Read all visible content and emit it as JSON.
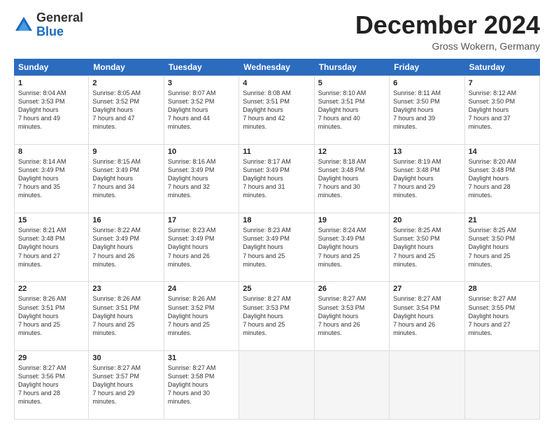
{
  "logo": {
    "general": "General",
    "blue": "Blue"
  },
  "header": {
    "month": "December 2024",
    "location": "Gross Wokern, Germany"
  },
  "days": [
    "Sunday",
    "Monday",
    "Tuesday",
    "Wednesday",
    "Thursday",
    "Friday",
    "Saturday"
  ],
  "weeks": [
    [
      {
        "day": "1",
        "sunrise": "8:04 AM",
        "sunset": "3:53 PM",
        "daylight": "7 hours and 49 minutes."
      },
      {
        "day": "2",
        "sunrise": "8:05 AM",
        "sunset": "3:52 PM",
        "daylight": "7 hours and 47 minutes."
      },
      {
        "day": "3",
        "sunrise": "8:07 AM",
        "sunset": "3:52 PM",
        "daylight": "7 hours and 44 minutes."
      },
      {
        "day": "4",
        "sunrise": "8:08 AM",
        "sunset": "3:51 PM",
        "daylight": "7 hours and 42 minutes."
      },
      {
        "day": "5",
        "sunrise": "8:10 AM",
        "sunset": "3:51 PM",
        "daylight": "7 hours and 40 minutes."
      },
      {
        "day": "6",
        "sunrise": "8:11 AM",
        "sunset": "3:50 PM",
        "daylight": "7 hours and 39 minutes."
      },
      {
        "day": "7",
        "sunrise": "8:12 AM",
        "sunset": "3:50 PM",
        "daylight": "7 hours and 37 minutes."
      }
    ],
    [
      {
        "day": "8",
        "sunrise": "8:14 AM",
        "sunset": "3:49 PM",
        "daylight": "7 hours and 35 minutes."
      },
      {
        "day": "9",
        "sunrise": "8:15 AM",
        "sunset": "3:49 PM",
        "daylight": "7 hours and 34 minutes."
      },
      {
        "day": "10",
        "sunrise": "8:16 AM",
        "sunset": "3:49 PM",
        "daylight": "7 hours and 32 minutes."
      },
      {
        "day": "11",
        "sunrise": "8:17 AM",
        "sunset": "3:49 PM",
        "daylight": "7 hours and 31 minutes."
      },
      {
        "day": "12",
        "sunrise": "8:18 AM",
        "sunset": "3:48 PM",
        "daylight": "7 hours and 30 minutes."
      },
      {
        "day": "13",
        "sunrise": "8:19 AM",
        "sunset": "3:48 PM",
        "daylight": "7 hours and 29 minutes."
      },
      {
        "day": "14",
        "sunrise": "8:20 AM",
        "sunset": "3:48 PM",
        "daylight": "7 hours and 28 minutes."
      }
    ],
    [
      {
        "day": "15",
        "sunrise": "8:21 AM",
        "sunset": "3:48 PM",
        "daylight": "7 hours and 27 minutes."
      },
      {
        "day": "16",
        "sunrise": "8:22 AM",
        "sunset": "3:49 PM",
        "daylight": "7 hours and 26 minutes."
      },
      {
        "day": "17",
        "sunrise": "8:23 AM",
        "sunset": "3:49 PM",
        "daylight": "7 hours and 26 minutes."
      },
      {
        "day": "18",
        "sunrise": "8:23 AM",
        "sunset": "3:49 PM",
        "daylight": "7 hours and 25 minutes."
      },
      {
        "day": "19",
        "sunrise": "8:24 AM",
        "sunset": "3:49 PM",
        "daylight": "7 hours and 25 minutes."
      },
      {
        "day": "20",
        "sunrise": "8:25 AM",
        "sunset": "3:50 PM",
        "daylight": "7 hours and 25 minutes."
      },
      {
        "day": "21",
        "sunrise": "8:25 AM",
        "sunset": "3:50 PM",
        "daylight": "7 hours and 25 minutes."
      }
    ],
    [
      {
        "day": "22",
        "sunrise": "8:26 AM",
        "sunset": "3:51 PM",
        "daylight": "7 hours and 25 minutes."
      },
      {
        "day": "23",
        "sunrise": "8:26 AM",
        "sunset": "3:51 PM",
        "daylight": "7 hours and 25 minutes."
      },
      {
        "day": "24",
        "sunrise": "8:26 AM",
        "sunset": "3:52 PM",
        "daylight": "7 hours and 25 minutes."
      },
      {
        "day": "25",
        "sunrise": "8:27 AM",
        "sunset": "3:53 PM",
        "daylight": "7 hours and 25 minutes."
      },
      {
        "day": "26",
        "sunrise": "8:27 AM",
        "sunset": "3:53 PM",
        "daylight": "7 hours and 26 minutes."
      },
      {
        "day": "27",
        "sunrise": "8:27 AM",
        "sunset": "3:54 PM",
        "daylight": "7 hours and 26 minutes."
      },
      {
        "day": "28",
        "sunrise": "8:27 AM",
        "sunset": "3:55 PM",
        "daylight": "7 hours and 27 minutes."
      }
    ],
    [
      {
        "day": "29",
        "sunrise": "8:27 AM",
        "sunset": "3:56 PM",
        "daylight": "7 hours and 28 minutes."
      },
      {
        "day": "30",
        "sunrise": "8:27 AM",
        "sunset": "3:57 PM",
        "daylight": "7 hours and 29 minutes."
      },
      {
        "day": "31",
        "sunrise": "8:27 AM",
        "sunset": "3:58 PM",
        "daylight": "7 hours and 30 minutes."
      },
      null,
      null,
      null,
      null
    ]
  ]
}
